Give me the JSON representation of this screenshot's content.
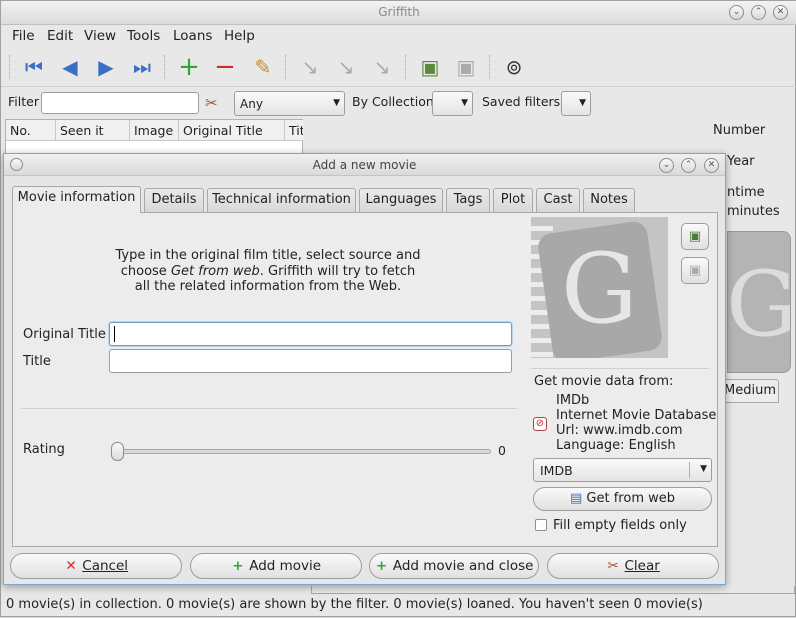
{
  "window": {
    "title": "Griffith"
  },
  "menu": [
    "File",
    "Edit",
    "View",
    "Tools",
    "Loans",
    "Help"
  ],
  "filter": {
    "label": "Filter",
    "value": "",
    "category": "Any",
    "by_collection_label": "By Collection",
    "collection": "",
    "saved_filters_label": "Saved filters",
    "saved": ""
  },
  "list": {
    "columns": [
      "No.",
      "Seen it",
      "Image",
      "Original Title",
      "Tit"
    ]
  },
  "right_panel": {
    "number": "Number",
    "year": "Year",
    "runtime": "ntime",
    "minutes": "minutes",
    "medium": "Medium"
  },
  "dialog": {
    "title": "Add a new movie",
    "tabs": [
      "Movie information",
      "Details",
      "Technical information",
      "Languages",
      "Tags",
      "Plot",
      "Cast",
      "Notes"
    ],
    "hint_line1": "Type in the original film title, select source and",
    "hint_line2a": "choose ",
    "hint_line2b": "Get from web",
    "hint_line2c": ". Griffith will try to fetch",
    "hint_line3": "all the related information from the Web.",
    "original_title_label": "Original Title",
    "original_title_value": "",
    "title_label": "Title",
    "title_value": "",
    "rating_label": "Rating",
    "rating_value": "0",
    "rating_fraction": 0,
    "get_data_label": "Get movie data from:",
    "source_name": "IMDb",
    "source_desc": "Internet Movie Database",
    "source_url": "Url: www.imdb.com",
    "source_lang": "Language: English",
    "source_select": "IMDB",
    "get_from_web": "Get from web",
    "fill_empty": "Fill empty fields only",
    "buttons": {
      "cancel": "Cancel",
      "add": "Add movie",
      "add_close": "Add movie and close",
      "clear": "Clear"
    }
  },
  "status": "0 movie(s) in collection. 0 movie(s) are shown by the filter. 0 movie(s) loaned. You haven't seen 0 movie(s)"
}
